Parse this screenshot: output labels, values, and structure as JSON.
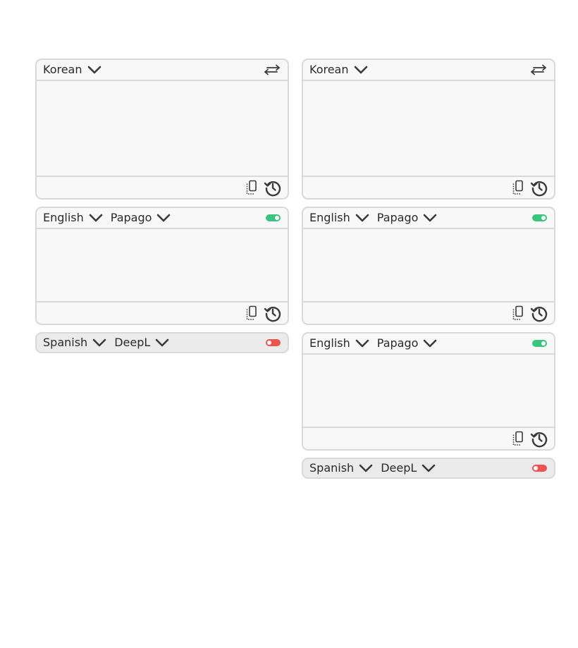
{
  "colors": {
    "toggle_on": "#3ac47d",
    "toggle_off": "#ef5350"
  },
  "left": {
    "source": {
      "language": "Korean",
      "icons": [
        "chevron-down-icon",
        "swap-icon",
        "copy-icon",
        "history-icon"
      ]
    },
    "target1": {
      "language": "English",
      "service": "Papago",
      "enabled": true
    },
    "target2": {
      "language": "Spanish",
      "service": "DeepL",
      "enabled": false
    }
  },
  "right": {
    "source": {
      "language": "Korean"
    },
    "target1": {
      "language": "English",
      "service": "Papago",
      "enabled": true
    },
    "target2": {
      "language": "English",
      "service": "Papago",
      "enabled": true
    },
    "target3": {
      "language": "Spanish",
      "service": "DeepL",
      "enabled": false
    }
  }
}
